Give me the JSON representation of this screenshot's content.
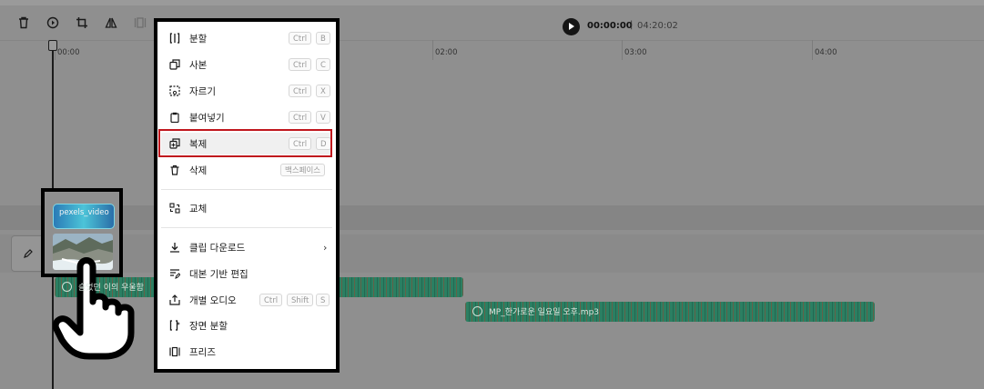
{
  "toolbar": {
    "icons": [
      "delete-icon",
      "speed-icon",
      "crop-icon",
      "flip-icon",
      "freeze-icon",
      "screen-icon"
    ]
  },
  "playback": {
    "current_time": "00:00:00",
    "separator": "|",
    "total_time": "04:20:02"
  },
  "ruler": {
    "labels": [
      "00:00",
      "02:00",
      "03:00",
      "04:00"
    ]
  },
  "clips": {
    "video_label": "pexels_video",
    "audio1_label": "슬었던 이의 우울함",
    "audio2_label": "MP_한가로운 일요일 오후.mp3"
  },
  "context_menu": {
    "items": [
      {
        "label": "분할",
        "keys": [
          "Ctrl",
          "B"
        ],
        "icon": "split-icon"
      },
      {
        "label": "사본",
        "keys": [
          "Ctrl",
          "C"
        ],
        "icon": "copy-icon"
      },
      {
        "label": "자르기",
        "keys": [
          "Ctrl",
          "X"
        ],
        "icon": "cut-icon"
      },
      {
        "label": "붙여넣기",
        "keys": [
          "Ctrl",
          "V"
        ],
        "icon": "paste-icon"
      },
      {
        "label": "복제",
        "keys": [
          "Ctrl",
          "D"
        ],
        "icon": "duplicate-icon"
      },
      {
        "label": "삭제",
        "keys": [
          "백스페이스"
        ],
        "icon": "trash-icon"
      },
      {
        "label": "교체",
        "keys": [],
        "icon": "replace-icon"
      },
      {
        "label": "클립 다운로드",
        "keys": [],
        "icon": "download-icon",
        "submenu": true
      },
      {
        "label": "대본 기반 편집",
        "keys": [],
        "icon": "script-edit-icon"
      },
      {
        "label": "개별 오디오",
        "keys": [
          "Ctrl",
          "Shift",
          "S"
        ],
        "icon": "separate-audio-icon"
      },
      {
        "label": "장면 분할",
        "keys": [],
        "icon": "scene-split-icon"
      },
      {
        "label": "프리즈",
        "keys": [],
        "icon": "freeze-icon"
      }
    ],
    "highlighted_label": "복제"
  },
  "colors": {
    "highlight_border": "#c0161d",
    "audio_clip": "#2b7f62",
    "overlay": "#8f8f8f"
  }
}
